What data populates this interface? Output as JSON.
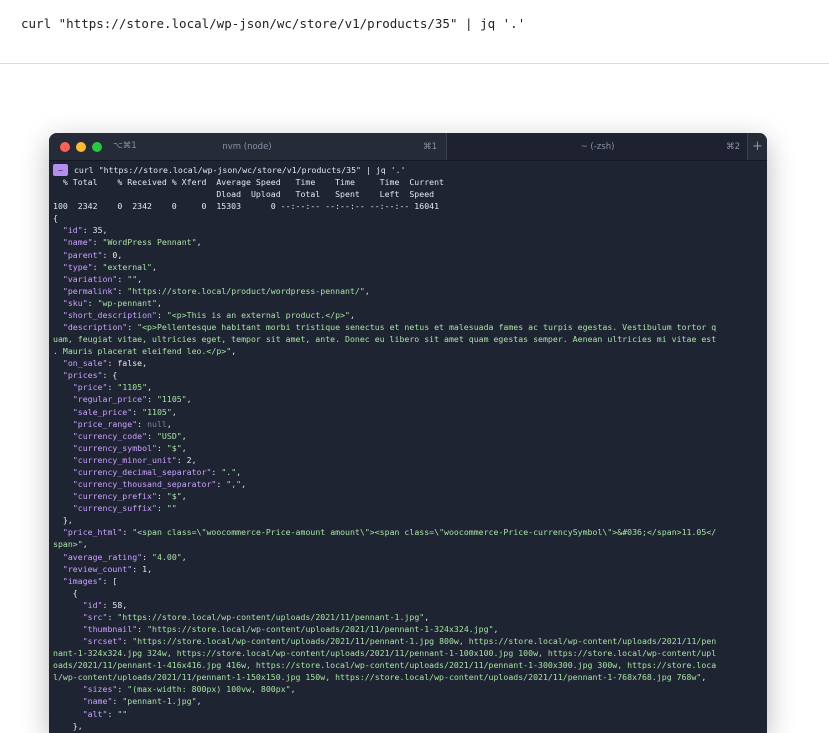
{
  "command_bar": {
    "text": "curl \"https://store.local/wp-json/wc/store/v1/products/35\" | jq '.'"
  },
  "window": {
    "tab1": {
      "shortcut": "⌥⌘1",
      "title": "nvm (node)",
      "key": "⌘1"
    },
    "tab2": {
      "title": "~ (-zsh)",
      "key": "⌘2"
    },
    "new_tab": "+"
  },
  "terminal": {
    "prompt": "~",
    "command": "curl \"https://store.local/wp-json/wc/store/v1/products/35\" | jq '.'",
    "progress": [
      "  % Total    % Received % Xferd  Average Speed   Time    Time     Time  Current",
      "                                 Dload  Upload   Total   Spent    Left  Speed",
      "100  2342    0  2342    0     0  15303      0 --:--:-- --:--:-- --:--:-- 16041"
    ],
    "json_lines": [
      [
        [
          "p",
          "{"
        ]
      ],
      [
        [
          "p",
          "  "
        ],
        [
          "k",
          "\"id\""
        ],
        [
          "p",
          ": "
        ],
        [
          "n",
          "35"
        ],
        [
          "p",
          ","
        ]
      ],
      [
        [
          "p",
          "  "
        ],
        [
          "k",
          "\"name\""
        ],
        [
          "p",
          ": "
        ],
        [
          "s",
          "\"WordPress Pennant\""
        ],
        [
          "p",
          ","
        ]
      ],
      [
        [
          "p",
          "  "
        ],
        [
          "k",
          "\"parent\""
        ],
        [
          "p",
          ": "
        ],
        [
          "n",
          "0"
        ],
        [
          "p",
          ","
        ]
      ],
      [
        [
          "p",
          "  "
        ],
        [
          "k",
          "\"type\""
        ],
        [
          "p",
          ": "
        ],
        [
          "s",
          "\"external\""
        ],
        [
          "p",
          ","
        ]
      ],
      [
        [
          "p",
          "  "
        ],
        [
          "k",
          "\"variation\""
        ],
        [
          "p",
          ": "
        ],
        [
          "s",
          "\"\""
        ],
        [
          "p",
          ","
        ]
      ],
      [
        [
          "p",
          "  "
        ],
        [
          "k",
          "\"permalink\""
        ],
        [
          "p",
          ": "
        ],
        [
          "s",
          "\"https://store.local/product/wordpress-pennant/\""
        ],
        [
          "p",
          ","
        ]
      ],
      [
        [
          "p",
          "  "
        ],
        [
          "k",
          "\"sku\""
        ],
        [
          "p",
          ": "
        ],
        [
          "s",
          "\"wp-pennant\""
        ],
        [
          "p",
          ","
        ]
      ],
      [
        [
          "p",
          "  "
        ],
        [
          "k",
          "\"short_description\""
        ],
        [
          "p",
          ": "
        ],
        [
          "s",
          "\"<p>This is an external product.</p>\""
        ],
        [
          "p",
          ","
        ]
      ],
      [
        [
          "p",
          "  "
        ],
        [
          "k",
          "\"description\""
        ],
        [
          "p",
          ": "
        ],
        [
          "s",
          "\"<p>Pellentesque habitant morbi tristique senectus et netus et malesuada fames ac turpis egestas. Vestibulum tortor q"
        ]
      ],
      [
        [
          "s",
          "uam, feugiat vitae, ultricies eget, tempor sit amet, ante. Donec eu libero sit amet quam egestas semper. Aenean ultricies mi vitae est"
        ]
      ],
      [
        [
          "s",
          ". Mauris placerat eleifend leo.</p>\""
        ],
        [
          "p",
          ","
        ]
      ],
      [
        [
          "p",
          "  "
        ],
        [
          "k",
          "\"on_sale\""
        ],
        [
          "p",
          ": "
        ],
        [
          "n",
          "false"
        ],
        [
          "p",
          ","
        ]
      ],
      [
        [
          "p",
          "  "
        ],
        [
          "k",
          "\"prices\""
        ],
        [
          "p",
          ": {"
        ]
      ],
      [
        [
          "p",
          "    "
        ],
        [
          "k",
          "\"price\""
        ],
        [
          "p",
          ": "
        ],
        [
          "s",
          "\"1105\""
        ],
        [
          "p",
          ","
        ]
      ],
      [
        [
          "p",
          "    "
        ],
        [
          "k",
          "\"regular_price\""
        ],
        [
          "p",
          ": "
        ],
        [
          "s",
          "\"1105\""
        ],
        [
          "p",
          ","
        ]
      ],
      [
        [
          "p",
          "    "
        ],
        [
          "k",
          "\"sale_price\""
        ],
        [
          "p",
          ": "
        ],
        [
          "s",
          "\"1105\""
        ],
        [
          "p",
          ","
        ]
      ],
      [
        [
          "p",
          "    "
        ],
        [
          "k",
          "\"price_range\""
        ],
        [
          "p",
          ": "
        ],
        [
          "nul",
          "null"
        ],
        [
          "p",
          ","
        ]
      ],
      [
        [
          "p",
          "    "
        ],
        [
          "k",
          "\"currency_code\""
        ],
        [
          "p",
          ": "
        ],
        [
          "s",
          "\"USD\""
        ],
        [
          "p",
          ","
        ]
      ],
      [
        [
          "p",
          "    "
        ],
        [
          "k",
          "\"currency_symbol\""
        ],
        [
          "p",
          ": "
        ],
        [
          "s",
          "\"$\""
        ],
        [
          "p",
          ","
        ]
      ],
      [
        [
          "p",
          "    "
        ],
        [
          "k",
          "\"currency_minor_unit\""
        ],
        [
          "p",
          ": "
        ],
        [
          "n",
          "2"
        ],
        [
          "p",
          ","
        ]
      ],
      [
        [
          "p",
          "    "
        ],
        [
          "k",
          "\"currency_decimal_separator\""
        ],
        [
          "p",
          ": "
        ],
        [
          "s",
          "\".\""
        ],
        [
          "p",
          ","
        ]
      ],
      [
        [
          "p",
          "    "
        ],
        [
          "k",
          "\"currency_thousand_separator\""
        ],
        [
          "p",
          ": "
        ],
        [
          "s",
          "\",\""
        ],
        [
          "p",
          ","
        ]
      ],
      [
        [
          "p",
          "    "
        ],
        [
          "k",
          "\"currency_prefix\""
        ],
        [
          "p",
          ": "
        ],
        [
          "s",
          "\"$\""
        ],
        [
          "p",
          ","
        ]
      ],
      [
        [
          "p",
          "    "
        ],
        [
          "k",
          "\"currency_suffix\""
        ],
        [
          "p",
          ": "
        ],
        [
          "s",
          "\"\""
        ]
      ],
      [
        [
          "p",
          "  },"
        ]
      ],
      [
        [
          "p",
          "  "
        ],
        [
          "k",
          "\"price_html\""
        ],
        [
          "p",
          ": "
        ],
        [
          "s",
          "\"<span class=\\\"woocommerce-Price-amount amount\\\"><span class=\\\"woocommerce-Price-currencySymbol\\\">&#036;</span>11.05</"
        ]
      ],
      [
        [
          "s",
          "span>\""
        ],
        [
          "p",
          ","
        ]
      ],
      [
        [
          "p",
          "  "
        ],
        [
          "k",
          "\"average_rating\""
        ],
        [
          "p",
          ": "
        ],
        [
          "s",
          "\"4.00\""
        ],
        [
          "p",
          ","
        ]
      ],
      [
        [
          "p",
          "  "
        ],
        [
          "k",
          "\"review_count\""
        ],
        [
          "p",
          ": "
        ],
        [
          "n",
          "1"
        ],
        [
          "p",
          ","
        ]
      ],
      [
        [
          "p",
          "  "
        ],
        [
          "k",
          "\"images\""
        ],
        [
          "p",
          ": ["
        ]
      ],
      [
        [
          "p",
          "    {"
        ]
      ],
      [
        [
          "p",
          "      "
        ],
        [
          "k",
          "\"id\""
        ],
        [
          "p",
          ": "
        ],
        [
          "n",
          "58"
        ],
        [
          "p",
          ","
        ]
      ],
      [
        [
          "p",
          "      "
        ],
        [
          "k",
          "\"src\""
        ],
        [
          "p",
          ": "
        ],
        [
          "s",
          "\"https://store.local/wp-content/uploads/2021/11/pennant-1.jpg\""
        ],
        [
          "p",
          ","
        ]
      ],
      [
        [
          "p",
          "      "
        ],
        [
          "k",
          "\"thumbnail\""
        ],
        [
          "p",
          ": "
        ],
        [
          "s",
          "\"https://store.local/wp-content/uploads/2021/11/pennant-1-324x324.jpg\""
        ],
        [
          "p",
          ","
        ]
      ],
      [
        [
          "p",
          "      "
        ],
        [
          "k",
          "\"srcset\""
        ],
        [
          "p",
          ": "
        ],
        [
          "s",
          "\"https://store.local/wp-content/uploads/2021/11/pennant-1.jpg 800w, https://store.local/wp-content/uploads/2021/11/pen"
        ]
      ],
      [
        [
          "s",
          "nant-1-324x324.jpg 324w, https://store.local/wp-content/uploads/2021/11/pennant-1-100x100.jpg 100w, https://store.local/wp-content/upl"
        ]
      ],
      [
        [
          "s",
          "oads/2021/11/pennant-1-416x416.jpg 416w, https://store.local/wp-content/uploads/2021/11/pennant-1-300x300.jpg 300w, https://store.loca"
        ]
      ],
      [
        [
          "s",
          "l/wp-content/uploads/2021/11/pennant-1-150x150.jpg 150w, https://store.local/wp-content/uploads/2021/11/pennant-1-768x768.jpg 768w\""
        ],
        [
          "p",
          ","
        ]
      ],
      [
        [
          "p",
          "      "
        ],
        [
          "k",
          "\"sizes\""
        ],
        [
          "p",
          ": "
        ],
        [
          "s",
          "\"(max-width: 800px) 100vw, 800px\""
        ],
        [
          "p",
          ","
        ]
      ],
      [
        [
          "p",
          "      "
        ],
        [
          "k",
          "\"name\""
        ],
        [
          "p",
          ": "
        ],
        [
          "s",
          "\"pennant-1.jpg\""
        ],
        [
          "p",
          ","
        ]
      ],
      [
        [
          "p",
          "      "
        ],
        [
          "k",
          "\"alt\""
        ],
        [
          "p",
          ": "
        ],
        [
          "s",
          "\"\""
        ]
      ],
      [
        [
          "p",
          "    },"
        ]
      ]
    ]
  }
}
